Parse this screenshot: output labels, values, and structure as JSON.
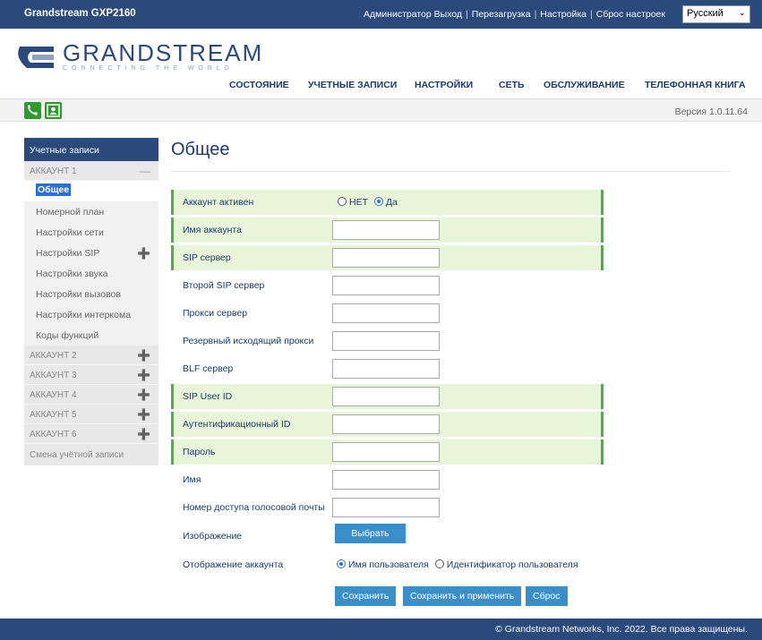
{
  "topbar": {
    "model": "Grandstream GXP2160",
    "links": [
      "Администратор Выход",
      "Перезагрузка",
      "Настройка",
      "Сброс настроек"
    ],
    "language": "Русский"
  },
  "logo": {
    "brand": "GRANDSTREAM",
    "tagline": "CONNECTING THE WORLD"
  },
  "nav": [
    "СОСТОЯНИЕ",
    "УЧЕТНЫЕ ЗАПИСИ",
    "НАСТРОЙКИ",
    "СЕТЬ",
    "ОБСЛУЖИВАНИЕ",
    "ТЕЛЕФОННАЯ КНИГА"
  ],
  "version": "Версия 1.0.11.64",
  "sidebar": {
    "header": "Учетные записи",
    "account1": "АККАУНТ 1",
    "items": [
      "Общее",
      "Номерной план",
      "Настройки сети",
      "Настройки SIP",
      "Настройки звука",
      "Настройки вызовов",
      "Настройки интеркома",
      "Коды функций"
    ],
    "accounts": [
      "АККАУНТ 2",
      "АККАУНТ 3",
      "АККАУНТ 4",
      "АККАУНТ 5",
      "АККАУНТ 6"
    ],
    "last": "Смена учётной записи"
  },
  "form": {
    "title": "Общее",
    "active_label": "Аккаунт активен",
    "active_no": "НЕТ",
    "active_yes": "Да",
    "fields": [
      "Имя аккаунта",
      "SIP сервер",
      "Второй SIP сервер",
      "Прокси сервер",
      "Резервный исходящий прокси",
      "BLF сервер",
      "SIP User ID",
      "Аутентификационный ID",
      "Пароль",
      "Имя",
      "Номер доступа голосовой почты"
    ],
    "image_label": "Изображение",
    "image_button": "Выбрать",
    "display_label": "Отображение аккаунта",
    "display_user": "Имя пользователя",
    "display_id": "Идентификатор пользователя",
    "save": "Сохранить",
    "save_apply": "Сохранить и применить",
    "reset": "Сброс"
  },
  "footer": "© Grandstream Networks, Inc. 2022. Все права защищены.",
  "colors": {
    "brand": "#2a4a7c",
    "highlight": "#e8f5d8",
    "button": "#3a8fc9",
    "accent_green": "#4caf4c"
  }
}
